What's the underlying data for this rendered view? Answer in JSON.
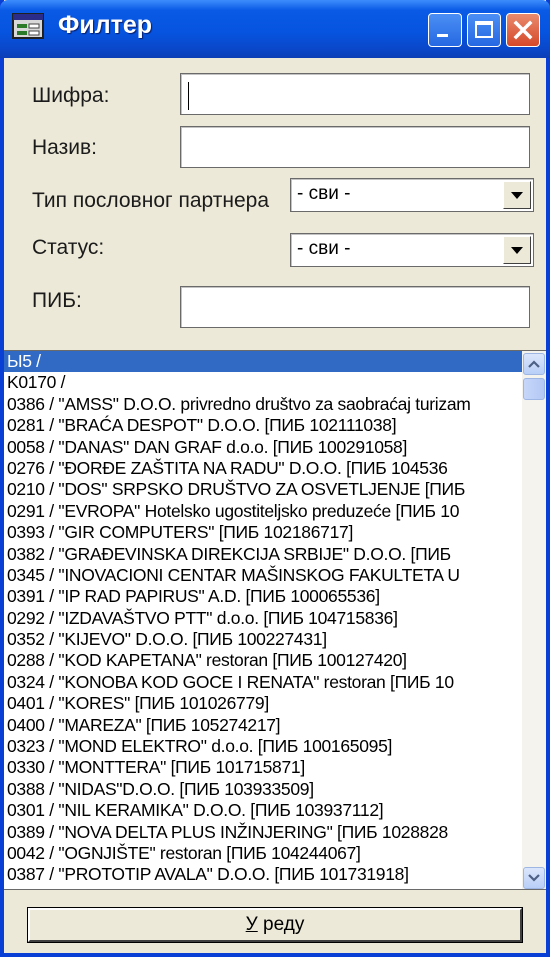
{
  "window": {
    "title": "Филтер",
    "icon": "form-app-icon",
    "buttons": {
      "minimize": "minimize-icon",
      "maximize": "maximize-icon",
      "close": "close-icon"
    }
  },
  "form": {
    "sifra_label": "Шифра:",
    "sifra_value": "",
    "naziv_label": "Назив:",
    "naziv_value": "",
    "tip_label": "Тип пословног партнера",
    "tip_value": "- сви -",
    "status_label": "Статус:",
    "status_value": "- сви -",
    "pib_label": "ПИБ:",
    "pib_value": ""
  },
  "list": {
    "selected_index": 0,
    "items": [
      "Ы5 /",
      "K0170 /",
      "0386 / \"AMSS\" D.O.O. privredno društvo za saobraćaj turizam",
      "0281 / \"BRAĆA DESPOT\" D.O.O. [ПИБ 102111038]",
      "0058 / \"DANAS\" DAN GRAF d.o.o. [ПИБ 100291058]",
      "0276 / \"ĐORĐE ZAŠTITA NA RADU\" D.O.O. [ПИБ 104536",
      "0210 / \"DOS\" SRPSKO DRUŠTVO ZA OSVETLJENJE [ПИБ",
      "0291 / \"EVROPA\" Hotelsko ugostiteljsko preduzeće [ПИБ 10",
      "0393 / \"GIR COMPUTERS\" [ПИБ 102186717]",
      "0382 / \"GRAĐEVINSKA DIREKCIJA SRBIJE\" D.O.O. [ПИБ",
      "0345 / \"INOVACIONI CENTAR MAŠINSKOG FAKULTETA U",
      "0391 / \"IP RAD PAPIRUS\" A.D. [ПИБ 100065536]",
      "0292 / \"IZDAVAŠTVO PTT\" d.o.o. [ПИБ 104715836]",
      "0352 / \"KIJEVO\" D.O.O. [ПИБ 100227431]",
      "0288 / \"KOD KAPETANA\" restoran [ПИБ 100127420]",
      "0324 / \"KONOBA KOD GOCE I RENATA\" restoran [ПИБ 10",
      "0401 / \"KORES\" [ПИБ 101026779]",
      "0400 / \"MAREZA\" [ПИБ 105274217]",
      "0323 / \"MOND ELEKTRO\" d.o.o. [ПИБ 100165095]",
      "0330 / \"MONTTERA\" [ПИБ 101715871]",
      "0388 / \"NIDAS\"D.O.O. [ПИБ 103933509]",
      "0301 / \"NIL KERAMIKA\" D.O.O. [ПИБ 103937112]",
      "0389 / \"NOVA DELTA PLUS INŽINJERING\" [ПИБ 1028828",
      "0042 / \"OGNJIŠTE\" restoran [ПИБ 104244067]",
      "0387 / \"PROTOTIP AVALA\" D.O.O. [ПИБ 101731918]"
    ]
  },
  "ok_button": {
    "underlined": "У",
    "rest": " реду"
  },
  "colors": {
    "titlebar": "#0654e0",
    "selection": "#316ac5",
    "dialog_bg": "#ece9d8"
  }
}
